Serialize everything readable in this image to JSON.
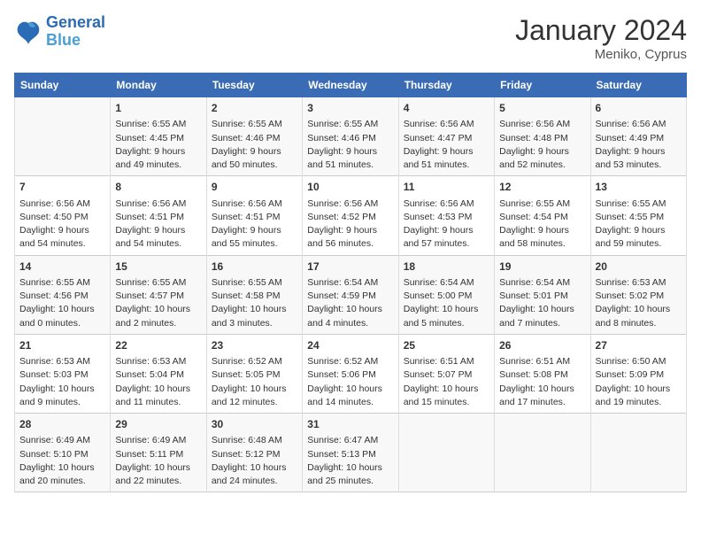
{
  "header": {
    "logo": {
      "line1": "General",
      "line2": "Blue"
    },
    "title": "January 2024",
    "location": "Meniko, Cyprus"
  },
  "weekdays": [
    "Sunday",
    "Monday",
    "Tuesday",
    "Wednesday",
    "Thursday",
    "Friday",
    "Saturday"
  ],
  "weeks": [
    [
      {
        "day": "",
        "sunrise": "",
        "sunset": "",
        "daylight": ""
      },
      {
        "day": "1",
        "sunrise": "Sunrise: 6:55 AM",
        "sunset": "Sunset: 4:45 PM",
        "daylight": "Daylight: 9 hours and 49 minutes."
      },
      {
        "day": "2",
        "sunrise": "Sunrise: 6:55 AM",
        "sunset": "Sunset: 4:46 PM",
        "daylight": "Daylight: 9 hours and 50 minutes."
      },
      {
        "day": "3",
        "sunrise": "Sunrise: 6:55 AM",
        "sunset": "Sunset: 4:46 PM",
        "daylight": "Daylight: 9 hours and 51 minutes."
      },
      {
        "day": "4",
        "sunrise": "Sunrise: 6:56 AM",
        "sunset": "Sunset: 4:47 PM",
        "daylight": "Daylight: 9 hours and 51 minutes."
      },
      {
        "day": "5",
        "sunrise": "Sunrise: 6:56 AM",
        "sunset": "Sunset: 4:48 PM",
        "daylight": "Daylight: 9 hours and 52 minutes."
      },
      {
        "day": "6",
        "sunrise": "Sunrise: 6:56 AM",
        "sunset": "Sunset: 4:49 PM",
        "daylight": "Daylight: 9 hours and 53 minutes."
      }
    ],
    [
      {
        "day": "7",
        "sunrise": "Sunrise: 6:56 AM",
        "sunset": "Sunset: 4:50 PM",
        "daylight": "Daylight: 9 hours and 54 minutes."
      },
      {
        "day": "8",
        "sunrise": "Sunrise: 6:56 AM",
        "sunset": "Sunset: 4:51 PM",
        "daylight": "Daylight: 9 hours and 54 minutes."
      },
      {
        "day": "9",
        "sunrise": "Sunrise: 6:56 AM",
        "sunset": "Sunset: 4:51 PM",
        "daylight": "Daylight: 9 hours and 55 minutes."
      },
      {
        "day": "10",
        "sunrise": "Sunrise: 6:56 AM",
        "sunset": "Sunset: 4:52 PM",
        "daylight": "Daylight: 9 hours and 56 minutes."
      },
      {
        "day": "11",
        "sunrise": "Sunrise: 6:56 AM",
        "sunset": "Sunset: 4:53 PM",
        "daylight": "Daylight: 9 hours and 57 minutes."
      },
      {
        "day": "12",
        "sunrise": "Sunrise: 6:55 AM",
        "sunset": "Sunset: 4:54 PM",
        "daylight": "Daylight: 9 hours and 58 minutes."
      },
      {
        "day": "13",
        "sunrise": "Sunrise: 6:55 AM",
        "sunset": "Sunset: 4:55 PM",
        "daylight": "Daylight: 9 hours and 59 minutes."
      }
    ],
    [
      {
        "day": "14",
        "sunrise": "Sunrise: 6:55 AM",
        "sunset": "Sunset: 4:56 PM",
        "daylight": "Daylight: 10 hours and 0 minutes."
      },
      {
        "day": "15",
        "sunrise": "Sunrise: 6:55 AM",
        "sunset": "Sunset: 4:57 PM",
        "daylight": "Daylight: 10 hours and 2 minutes."
      },
      {
        "day": "16",
        "sunrise": "Sunrise: 6:55 AM",
        "sunset": "Sunset: 4:58 PM",
        "daylight": "Daylight: 10 hours and 3 minutes."
      },
      {
        "day": "17",
        "sunrise": "Sunrise: 6:54 AM",
        "sunset": "Sunset: 4:59 PM",
        "daylight": "Daylight: 10 hours and 4 minutes."
      },
      {
        "day": "18",
        "sunrise": "Sunrise: 6:54 AM",
        "sunset": "Sunset: 5:00 PM",
        "daylight": "Daylight: 10 hours and 5 minutes."
      },
      {
        "day": "19",
        "sunrise": "Sunrise: 6:54 AM",
        "sunset": "Sunset: 5:01 PM",
        "daylight": "Daylight: 10 hours and 7 minutes."
      },
      {
        "day": "20",
        "sunrise": "Sunrise: 6:53 AM",
        "sunset": "Sunset: 5:02 PM",
        "daylight": "Daylight: 10 hours and 8 minutes."
      }
    ],
    [
      {
        "day": "21",
        "sunrise": "Sunrise: 6:53 AM",
        "sunset": "Sunset: 5:03 PM",
        "daylight": "Daylight: 10 hours and 9 minutes."
      },
      {
        "day": "22",
        "sunrise": "Sunrise: 6:53 AM",
        "sunset": "Sunset: 5:04 PM",
        "daylight": "Daylight: 10 hours and 11 minutes."
      },
      {
        "day": "23",
        "sunrise": "Sunrise: 6:52 AM",
        "sunset": "Sunset: 5:05 PM",
        "daylight": "Daylight: 10 hours and 12 minutes."
      },
      {
        "day": "24",
        "sunrise": "Sunrise: 6:52 AM",
        "sunset": "Sunset: 5:06 PM",
        "daylight": "Daylight: 10 hours and 14 minutes."
      },
      {
        "day": "25",
        "sunrise": "Sunrise: 6:51 AM",
        "sunset": "Sunset: 5:07 PM",
        "daylight": "Daylight: 10 hours and 15 minutes."
      },
      {
        "day": "26",
        "sunrise": "Sunrise: 6:51 AM",
        "sunset": "Sunset: 5:08 PM",
        "daylight": "Daylight: 10 hours and 17 minutes."
      },
      {
        "day": "27",
        "sunrise": "Sunrise: 6:50 AM",
        "sunset": "Sunset: 5:09 PM",
        "daylight": "Daylight: 10 hours and 19 minutes."
      }
    ],
    [
      {
        "day": "28",
        "sunrise": "Sunrise: 6:49 AM",
        "sunset": "Sunset: 5:10 PM",
        "daylight": "Daylight: 10 hours and 20 minutes."
      },
      {
        "day": "29",
        "sunrise": "Sunrise: 6:49 AM",
        "sunset": "Sunset: 5:11 PM",
        "daylight": "Daylight: 10 hours and 22 minutes."
      },
      {
        "day": "30",
        "sunrise": "Sunrise: 6:48 AM",
        "sunset": "Sunset: 5:12 PM",
        "daylight": "Daylight: 10 hours and 24 minutes."
      },
      {
        "day": "31",
        "sunrise": "Sunrise: 6:47 AM",
        "sunset": "Sunset: 5:13 PM",
        "daylight": "Daylight: 10 hours and 25 minutes."
      },
      {
        "day": "",
        "sunrise": "",
        "sunset": "",
        "daylight": ""
      },
      {
        "day": "",
        "sunrise": "",
        "sunset": "",
        "daylight": ""
      },
      {
        "day": "",
        "sunrise": "",
        "sunset": "",
        "daylight": ""
      }
    ]
  ]
}
